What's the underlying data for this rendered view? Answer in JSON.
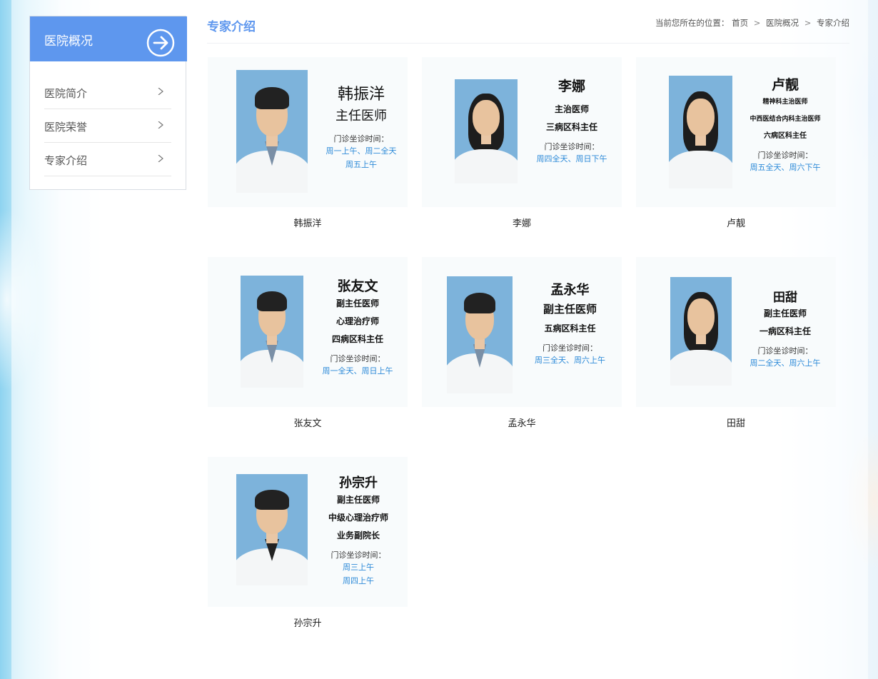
{
  "sidebar": {
    "title": "医院概况",
    "items": [
      {
        "label": "医院简介"
      },
      {
        "label": "医院荣誉"
      },
      {
        "label": "专家介绍"
      }
    ]
  },
  "main": {
    "title": "专家介绍",
    "breadcrumb": {
      "prefix": "当前您所在的位置：",
      "items": [
        "首页",
        "医院概况",
        "专家介绍"
      ],
      "separator": ">"
    }
  },
  "doctors": [
    {
      "name": "韩振洋",
      "titles": [
        "主任医师"
      ],
      "hours_label": "门诊坐诊时间：",
      "hours": [
        "周一上午、周二全天",
        "周五上午"
      ]
    },
    {
      "name": "李娜",
      "titles": [
        "主治医师",
        "三病区科主任"
      ],
      "hours_label": "门诊坐诊时间：",
      "hours": [
        "周四全天、周日下午"
      ]
    },
    {
      "name": "卢靓",
      "titles": [
        "精神科主治医师",
        "中西医结合内科主治医师",
        "六病区科主任"
      ],
      "hours_label": "门诊坐诊时间：",
      "hours": [
        "周五全天、周六下午"
      ]
    },
    {
      "name": "张友文",
      "titles": [
        "副主任医师",
        "心理治疗师",
        "四病区科主任"
      ],
      "hours_label": "门诊坐诊时间：",
      "hours": [
        "周一全天、周日上午"
      ]
    },
    {
      "name": "孟永华",
      "titles": [
        "副主任医师",
        "五病区科主任"
      ],
      "hours_label": "门诊坐诊时间：",
      "hours": [
        "周三全天、周六上午"
      ]
    },
    {
      "name": "田甜",
      "titles": [
        "副主任医师",
        "一病区科主任"
      ],
      "hours_label": "门诊坐诊时间：",
      "hours": [
        "周二全天、周六上午"
      ]
    },
    {
      "name": "孙宗升",
      "titles": [
        "副主任医师",
        "中级心理治疗师",
        "业务副院长"
      ],
      "hours_label": "门诊坐诊时间：",
      "hours": [
        "周三上午",
        "周四上午"
      ]
    }
  ],
  "colors": {
    "accent": "#5e97ee",
    "hours_text": "#2c8ad8",
    "photo_bg": "#7db3db"
  },
  "icons": {
    "sidebar_head": "arrow-right-circle-icon",
    "sidebar_item": "chevron-right-icon"
  }
}
